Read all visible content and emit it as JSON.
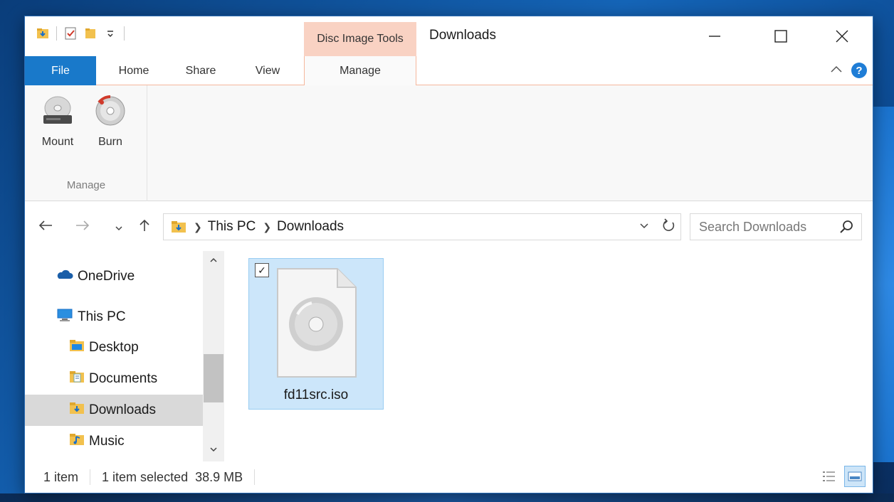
{
  "window": {
    "title": "Downloads",
    "contextual_tab_group": "Disc Image Tools"
  },
  "tabs": [
    {
      "label": "File",
      "active": false
    },
    {
      "label": "Home",
      "active": false
    },
    {
      "label": "Share",
      "active": false
    },
    {
      "label": "View",
      "active": false
    },
    {
      "label": "Manage",
      "active": true
    }
  ],
  "ribbon": {
    "group_label": "Manage",
    "buttons": [
      {
        "label": "Mount",
        "icon": "disc-drive-icon"
      },
      {
        "label": "Burn",
        "icon": "burn-disc-icon"
      }
    ]
  },
  "address": {
    "parts": [
      "This PC",
      "Downloads"
    ],
    "search_placeholder": "Search Downloads"
  },
  "nav_pane": {
    "items": [
      {
        "label": "OneDrive",
        "icon": "onedrive-icon",
        "selected": false
      },
      {
        "label": "This PC",
        "icon": "this-pc-icon",
        "selected": false
      },
      {
        "label": "Desktop",
        "icon": "desktop-folder-icon",
        "selected": false
      },
      {
        "label": "Documents",
        "icon": "documents-folder-icon",
        "selected": false
      },
      {
        "label": "Downloads",
        "icon": "downloads-folder-icon",
        "selected": true
      },
      {
        "label": "Music",
        "icon": "music-folder-icon",
        "selected": false
      }
    ]
  },
  "files": [
    {
      "name": "fd11src.iso",
      "icon": "disc-image-file-icon",
      "selected": true,
      "checked": true
    }
  ],
  "status": {
    "item_count": "1 item",
    "selection": "1 item selected  38.9 MB"
  },
  "colors": {
    "file_tab": "#1979ca",
    "contextual_tab": "#f9d2c3",
    "selection": "#cce6fa",
    "help": "#1f7dd6"
  }
}
